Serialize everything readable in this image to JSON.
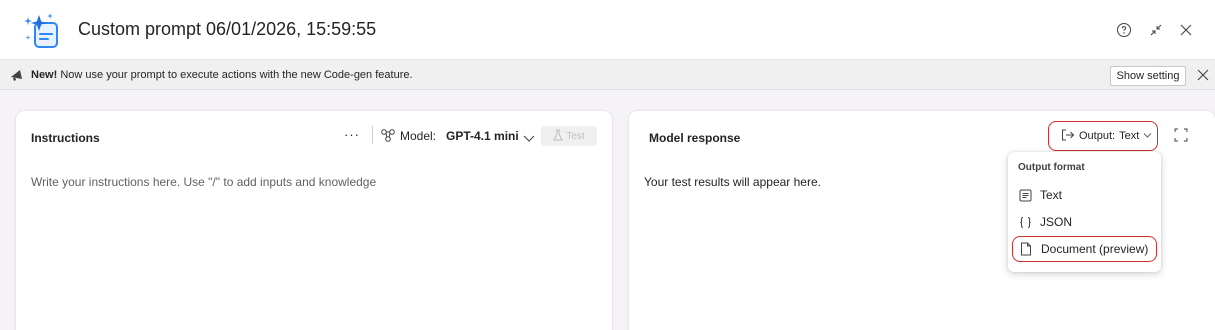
{
  "titlebar": {
    "title": "Custom prompt 06/01/2026, 15:59:55",
    "help_icon": "help-icon",
    "minimize_icon": "collapse-icon",
    "close_icon": "close-icon"
  },
  "banner": {
    "bold": "New!",
    "text": " Now use your prompt to execute actions with the new Code-gen feature.",
    "show_setting": "Show setting"
  },
  "instructions": {
    "title": "Instructions",
    "more": "···",
    "model_label": "Model:",
    "model_value": "GPT-4.1 mini",
    "test_label": "Test",
    "placeholder": "Write your instructions here. Use \"/\" to add inputs and knowledge"
  },
  "response": {
    "title": "Model response",
    "output_label": "Output:",
    "output_value": "Text",
    "empty_text": "Your test results will appear here."
  },
  "output_menu": {
    "header": "Output format",
    "items": [
      {
        "label": "Text",
        "icon": "text-doc-icon"
      },
      {
        "label": "JSON",
        "icon": "braces-icon"
      },
      {
        "label": "Document (preview)",
        "icon": "document-icon"
      }
    ]
  },
  "colors": {
    "highlight": "#d32f2f",
    "accent": "#2f86f6"
  }
}
